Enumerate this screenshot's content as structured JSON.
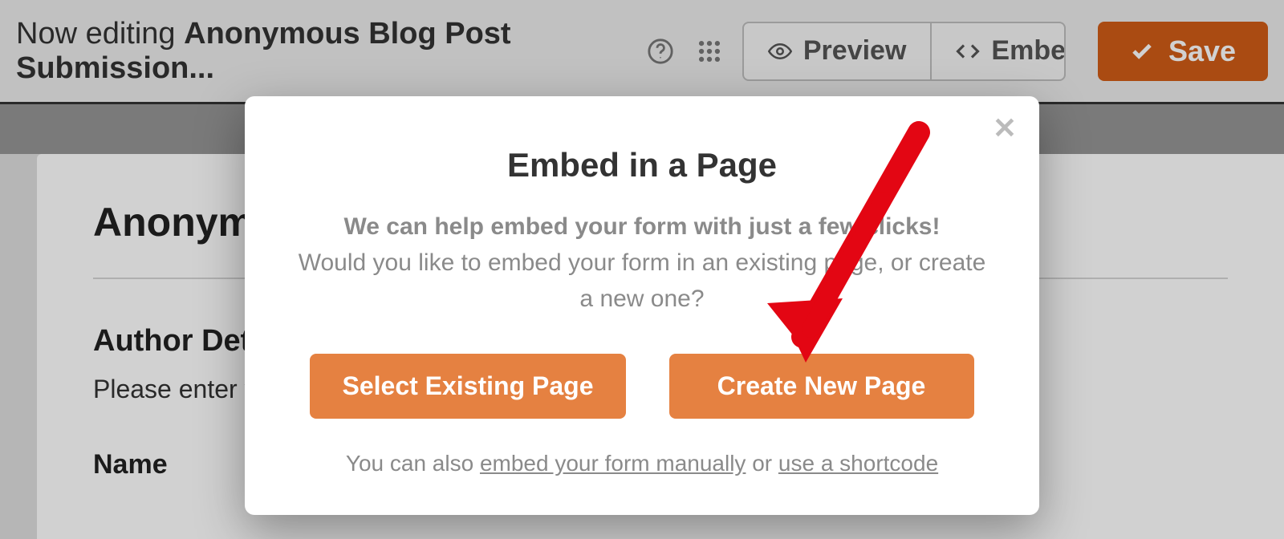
{
  "topbar": {
    "editing_prefix": "Now editing ",
    "form_name": "Anonymous Blog Post Submission...",
    "preview_label": "Preview",
    "embed_label": "Embed",
    "save_label": "Save"
  },
  "background": {
    "form_title": "Anonym",
    "section_title": "Author Deta",
    "section_sub": "Please enter y",
    "field_label": "Name"
  },
  "modal": {
    "title": "Embed in a Page",
    "lead": "We can help embed your form with just a few clicks!",
    "question": "Would you like to embed your form in an existing page, or create a new one?",
    "select_existing_label": "Select Existing Page",
    "create_new_label": "Create New Page",
    "foot_prefix": "You can also ",
    "foot_link1": "embed your form manually",
    "foot_mid": " or ",
    "foot_link2": "use a shortcode"
  },
  "colors": {
    "accent": "#e58141",
    "save": "#d05c17"
  }
}
